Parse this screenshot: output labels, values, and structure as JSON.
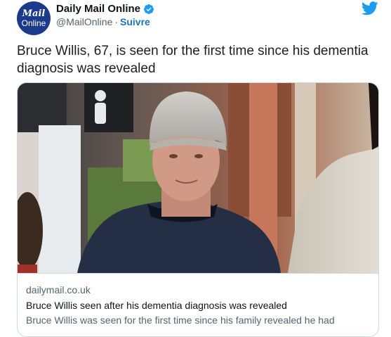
{
  "account": {
    "avatar_line1": "Mail",
    "avatar_line2": "Online",
    "display_name": "Daily Mail Online",
    "handle": "@MailOnline",
    "separator": "·",
    "follow_label": "Suivre"
  },
  "icons": {
    "verified": "verified-badge-icon",
    "platform": "twitter-bird-icon"
  },
  "colors": {
    "avatar_bg": "#1b3a8c",
    "verified": "#1d9bf0",
    "follow": "#1b75bb",
    "twitter": "#1d9bf0"
  },
  "tweet": {
    "text": "Bruce Willis, 67, is seen for the first time since his dementia diagnosis was revealed"
  },
  "card": {
    "domain": "dailymail.co.uk",
    "title": "Bruce Willis seen after his dementia diagnosis was revealed",
    "description": "Bruce Willis was seen for the first time since his family revealed he had"
  }
}
